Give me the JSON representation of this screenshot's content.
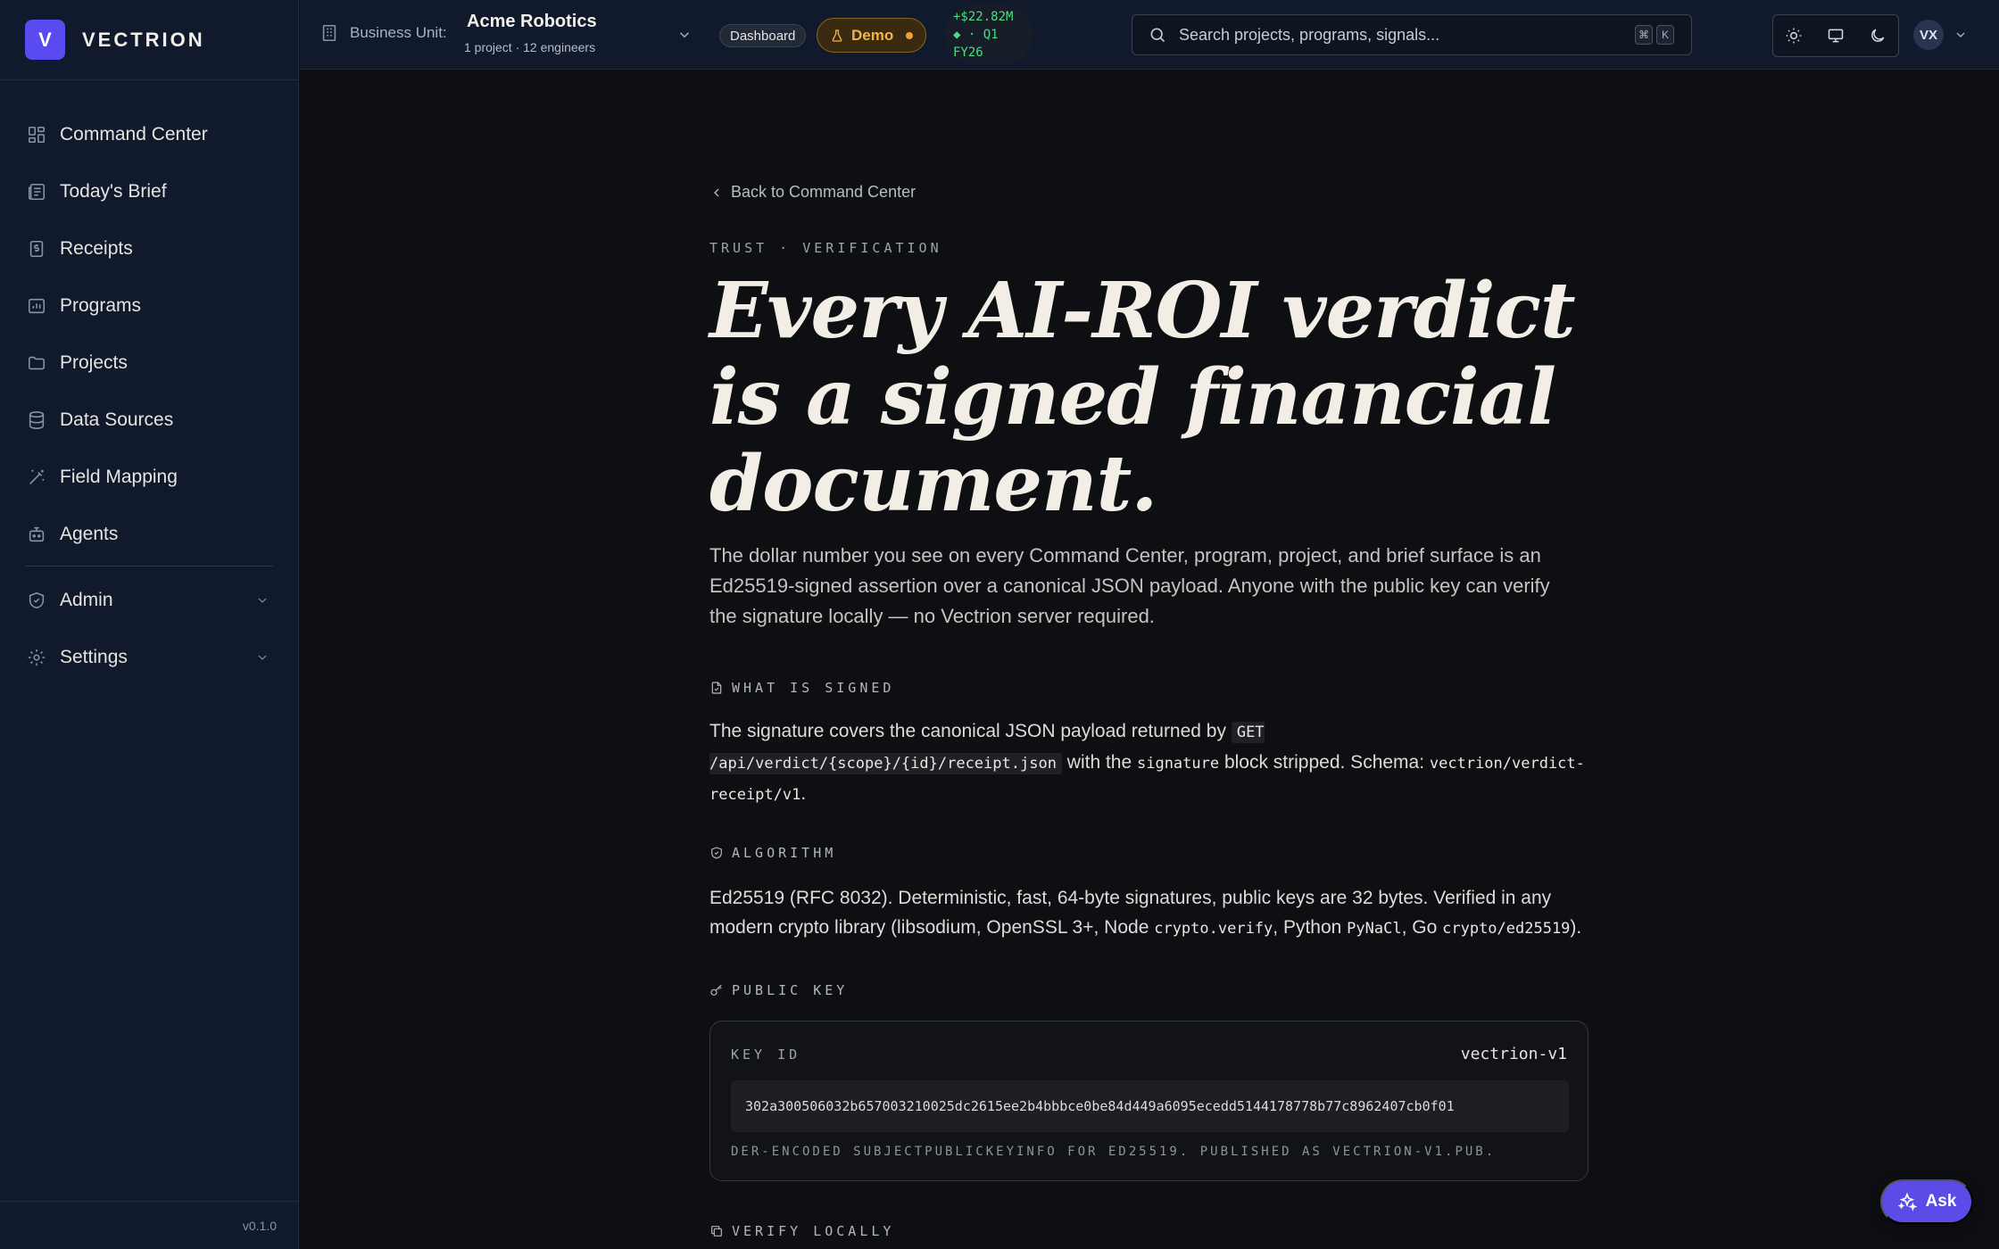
{
  "app": {
    "brand_initial": "V",
    "brand_name": "VECTRION",
    "version": "v0.1.0"
  },
  "sidebar": {
    "items": [
      {
        "label": "Command Center",
        "icon": "grid-icon"
      },
      {
        "label": "Today's Brief",
        "icon": "newspaper-icon"
      },
      {
        "label": "Receipts",
        "icon": "receipt-icon"
      },
      {
        "label": "Programs",
        "icon": "chart-icon"
      },
      {
        "label": "Projects",
        "icon": "folder-icon"
      },
      {
        "label": "Data Sources",
        "icon": "database-icon"
      },
      {
        "label": "Field Mapping",
        "icon": "wand-icon"
      },
      {
        "label": "Agents",
        "icon": "bot-icon"
      }
    ],
    "admin": {
      "label": "Admin",
      "icon": "shield-icon"
    },
    "settings": {
      "label": "Settings",
      "icon": "gear-icon"
    }
  },
  "topbar": {
    "business_unit_label": "Business Unit:",
    "business_unit_name": "Acme Robotics",
    "business_unit_sub": "1 project · 12 engineers",
    "dashboard_pill": "Dashboard",
    "demo_pill": "Demo",
    "roi_line1": "+$22.82M",
    "roi_line2": "◆ · Q1",
    "roi_line3": "FY26",
    "search_placeholder": "Search projects, programs, signals...",
    "kbd_cmd": "⌘",
    "kbd_k": "K",
    "avatar_initials": "VX"
  },
  "page": {
    "back_link": "Back to Command Center",
    "eyebrow": "TRUST · VERIFICATION",
    "headline": "Every AI-ROI verdict is a signed financial document.",
    "lede": "The dollar number you see on every Command Center, program, project, and brief surface is an Ed25519-signed assertion over a canonical JSON payload. Anyone with the public key can verify the signature locally — no Vectrion server required.",
    "what_signed": {
      "heading": "WHAT IS SIGNED",
      "text_1": "The signature covers the canonical JSON payload returned by ",
      "code_1": "GET /api/verdict/{scope}/{id}/receipt.json",
      "text_2": " with the ",
      "code_2": "signature",
      "text_3": " block stripped. Schema: ",
      "code_3": "vectrion/verdict-receipt/v1",
      "text_4": "."
    },
    "algorithm": {
      "heading": "ALGORITHM",
      "text_1": "Ed25519 (RFC 8032). Deterministic, fast, 64-byte signatures, public keys are 32 bytes. Verified in any modern crypto library (libsodium, OpenSSL 3+, Node ",
      "code_1": "crypto.verify",
      "text_2": ", Python ",
      "code_2": "PyNaCl",
      "text_3": ", Go ",
      "code_3": "crypto/ed25519",
      "text_4": ")."
    },
    "public_key": {
      "heading": "PUBLIC KEY",
      "key_id_label": "KEY ID",
      "key_id_value": "vectrion-v1",
      "key_hex": "302a300506032b657003210025dc2615ee2b4bbbce0be84d449a6095ecedd5144178778b77c8962407cb0f01",
      "note": "DER-ENCODED SUBJECTPUBLICKEYINFO FOR ED25519. PUBLISHED AS VECTRION-V1.PUB."
    },
    "verify_heading": "VERIFY LOCALLY"
  },
  "ask_button": "Ask",
  "colors": {
    "accent": "#5a4bf0",
    "demo": "#f0b548",
    "roi_positive": "#4ade80"
  }
}
